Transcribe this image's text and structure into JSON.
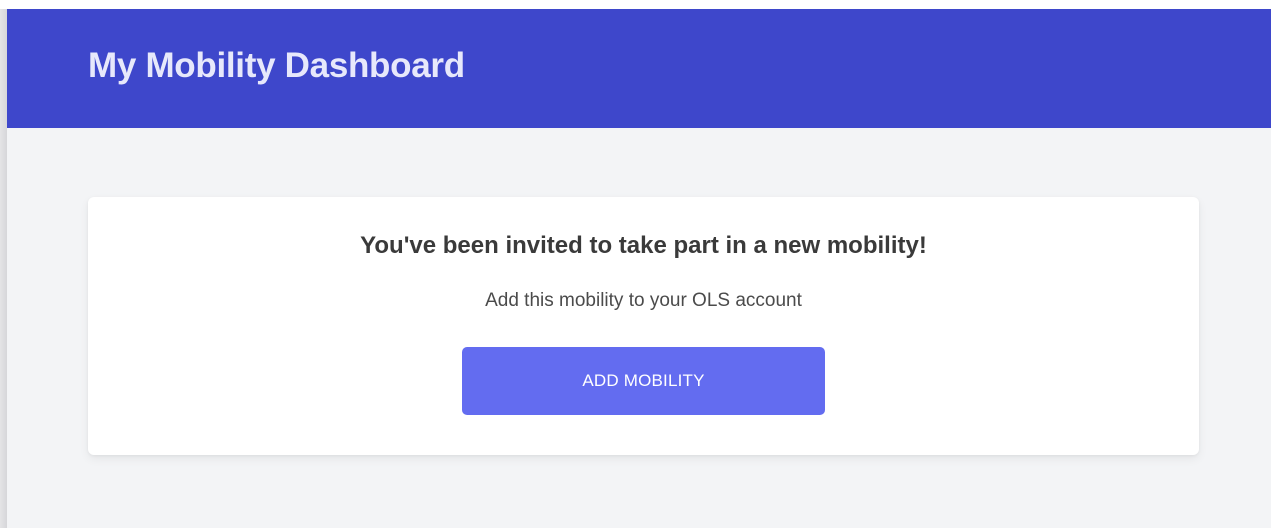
{
  "header": {
    "title": "My Mobility Dashboard"
  },
  "invite_card": {
    "heading": "You've been invited to take part in a new mobility!",
    "subtext": "Add this mobility to your OLS account",
    "add_button_label": "ADD MOBILITY"
  },
  "colors": {
    "header_background": "#3e47cb",
    "header_text": "#e7e8fb",
    "page_background": "#f3f4f6",
    "card_background": "#ffffff",
    "button_background": "#636cf0",
    "button_text": "#ffffff",
    "heading_text": "#3a3a3a"
  }
}
